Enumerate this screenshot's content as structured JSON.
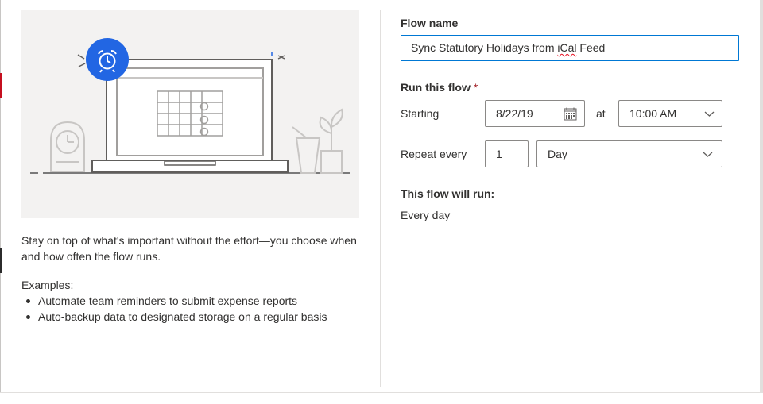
{
  "illustration": {
    "icons": [
      "alarm-clock-icon",
      "laptop-icon",
      "calendar-icon",
      "desk-clock-icon",
      "plant-icon",
      "cup-icon"
    ],
    "accent_color": "#2266e3"
  },
  "left": {
    "description": "Stay on top of what's important without the effort—you choose when and how often the flow runs.",
    "examples_label": "Examples:",
    "examples": [
      "Automate team reminders to submit expense reports",
      "Auto-backup data to designated storage on a regular basis"
    ]
  },
  "form": {
    "flow_name_label": "Flow name",
    "flow_name_value_start": "Sync Statutory Holidays from ",
    "flow_name_value_spell": "iCal",
    "flow_name_value_end": " Feed",
    "run_label": "Run this flow",
    "required_mark": "*",
    "starting_label": "Starting",
    "date_value": "8/22/19",
    "at_label": "at",
    "time_value": "10:00 AM",
    "repeat_label": "Repeat every",
    "interval_value": "1",
    "frequency_value": "Day",
    "summary_label": "This flow will run:",
    "summary_value": "Every day"
  },
  "colors": {
    "primary": "#0078d4",
    "required": "#a4262c",
    "border": "#8a8886"
  }
}
